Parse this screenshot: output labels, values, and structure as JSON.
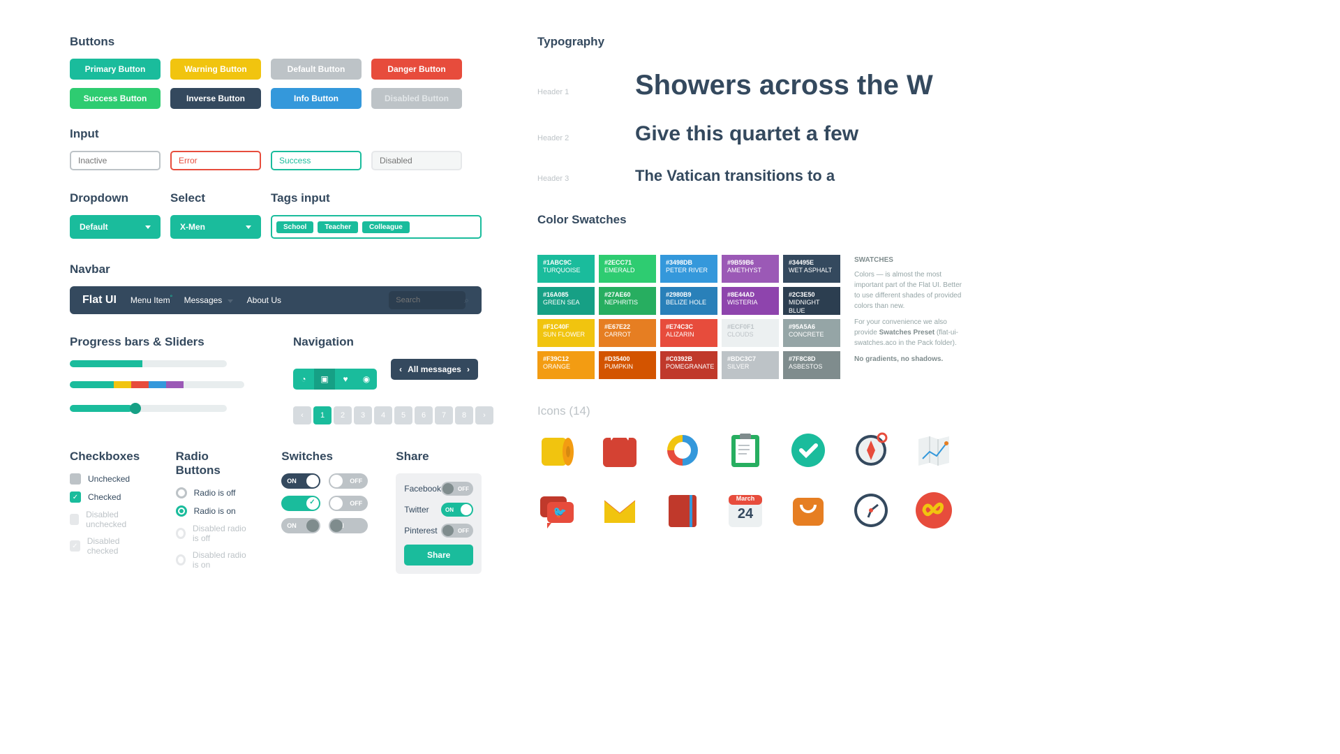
{
  "sections": {
    "buttons": "Buttons",
    "input": "Input",
    "dropdown": "Dropdown",
    "select": "Select",
    "tags": "Tags input",
    "navbar": "Navbar",
    "progress": "Progress bars & Sliders",
    "navigation": "Navigation",
    "checkboxes": "Checkboxes",
    "radio": "Radio Buttons",
    "switches": "Switches",
    "share": "Share",
    "typography": "Typography",
    "swatches": "Color Swatches",
    "icons": "Icons",
    "icons_count": "(14)"
  },
  "buttons": {
    "primary": "Primary Button",
    "warning": "Warning Button",
    "default": "Default Button",
    "danger": "Danger Button",
    "success": "Success Button",
    "inverse": "Inverse Button",
    "info": "Info Button",
    "disabled": "Disabled Button"
  },
  "inputs": {
    "inactive": "Inactive",
    "error": "Error",
    "success": "Success",
    "disabled": "Disabled"
  },
  "dropdown": {
    "label": "Default"
  },
  "select": {
    "label": "X-Men"
  },
  "tags": [
    "School",
    "Teacher",
    "Colleague"
  ],
  "navbar": {
    "brand": "Flat UI",
    "menu1": "Menu Item",
    "menu2": "Messages",
    "menu3": "About Us",
    "search": "Search"
  },
  "navigation": {
    "all_messages": "All messages",
    "pages": [
      "1",
      "2",
      "3",
      "4",
      "5",
      "6",
      "7",
      "8"
    ]
  },
  "checkboxes": {
    "unchecked": "Unchecked",
    "checked": "Checked",
    "dis_unchecked": "Disabled unchecked",
    "dis_checked": "Disabled checked"
  },
  "radio": {
    "off": "Radio is off",
    "on": "Radio is on",
    "dis_off": "Disabled radio is off",
    "dis_on": "Disabled radio is on"
  },
  "switches": {
    "on": "ON",
    "off": "OFF"
  },
  "share": {
    "facebook": "Facebook",
    "twitter": "Twitter",
    "pinterest": "Pinterest",
    "button": "Share"
  },
  "typography": {
    "h1_label": "Header 1",
    "h2_label": "Header 2",
    "h3_label": "Header 3",
    "h1_text": "Showers across the W",
    "h2_text": "Give this quartet a few",
    "h3_text": "The Vatican transitions to a"
  },
  "swatches": [
    {
      "hex": "#1ABC9C",
      "name": "TURQUOISE",
      "bg": "#1abc9c"
    },
    {
      "hex": "#2ECC71",
      "name": "EMERALD",
      "bg": "#2ecc71"
    },
    {
      "hex": "#3498DB",
      "name": "PETER RIVER",
      "bg": "#3498db"
    },
    {
      "hex": "#9B59B6",
      "name": "AMETHYST",
      "bg": "#9b59b6"
    },
    {
      "hex": "#34495E",
      "name": "WET ASPHALT",
      "bg": "#34495e"
    },
    {
      "hex": "#16A085",
      "name": "GREEN SEA",
      "bg": "#16a085"
    },
    {
      "hex": "#27AE60",
      "name": "NEPHRITIS",
      "bg": "#27ae60"
    },
    {
      "hex": "#2980B9",
      "name": "BELIZE HOLE",
      "bg": "#2980b9"
    },
    {
      "hex": "#8E44AD",
      "name": "WISTERIA",
      "bg": "#8e44ad"
    },
    {
      "hex": "#2C3E50",
      "name": "MIDNIGHT BLUE",
      "bg": "#2c3e50"
    },
    {
      "hex": "#F1C40F",
      "name": "SUN FLOWER",
      "bg": "#f1c40f"
    },
    {
      "hex": "#E67E22",
      "name": "CARROT",
      "bg": "#e67e22"
    },
    {
      "hex": "#E74C3C",
      "name": "ALIZARIN",
      "bg": "#e74c3c"
    },
    {
      "hex": "#ECF0F1",
      "name": "CLOUDS",
      "bg": "#ecf0f1",
      "light": true
    },
    {
      "hex": "#95A5A6",
      "name": "CONCRETE",
      "bg": "#95a5a6"
    },
    {
      "hex": "#F39C12",
      "name": "ORANGE",
      "bg": "#f39c12"
    },
    {
      "hex": "#D35400",
      "name": "PUMPKIN",
      "bg": "#d35400"
    },
    {
      "hex": "#C0392B",
      "name": "POMEGRANATE",
      "bg": "#c0392b"
    },
    {
      "hex": "#BDC3C7",
      "name": "SILVER",
      "bg": "#bdc3c7"
    },
    {
      "hex": "#7F8C8D",
      "name": "ASBESTOS",
      "bg": "#7f8c8d"
    }
  ],
  "swatches_text": {
    "title": "SWATCHES",
    "p1": "Colors — is almost the most important part of the Flat UI. Better to use different shades of provided colors than new.",
    "p2a": "For your convenience we also provide ",
    "p2b": "Swatches Preset",
    "p2c": " (flat-ui-swatches.aco in the Pack folder).",
    "p3": "No gradients, no shadows."
  },
  "icons": [
    "toilet-paper",
    "gift-box",
    "ring-chart",
    "clipboard",
    "check-badge",
    "compass",
    "map",
    "chat",
    "mail",
    "book",
    "calendar",
    "bag",
    "clock",
    "infinity"
  ],
  "calendar": {
    "month": "March",
    "day": "24"
  }
}
